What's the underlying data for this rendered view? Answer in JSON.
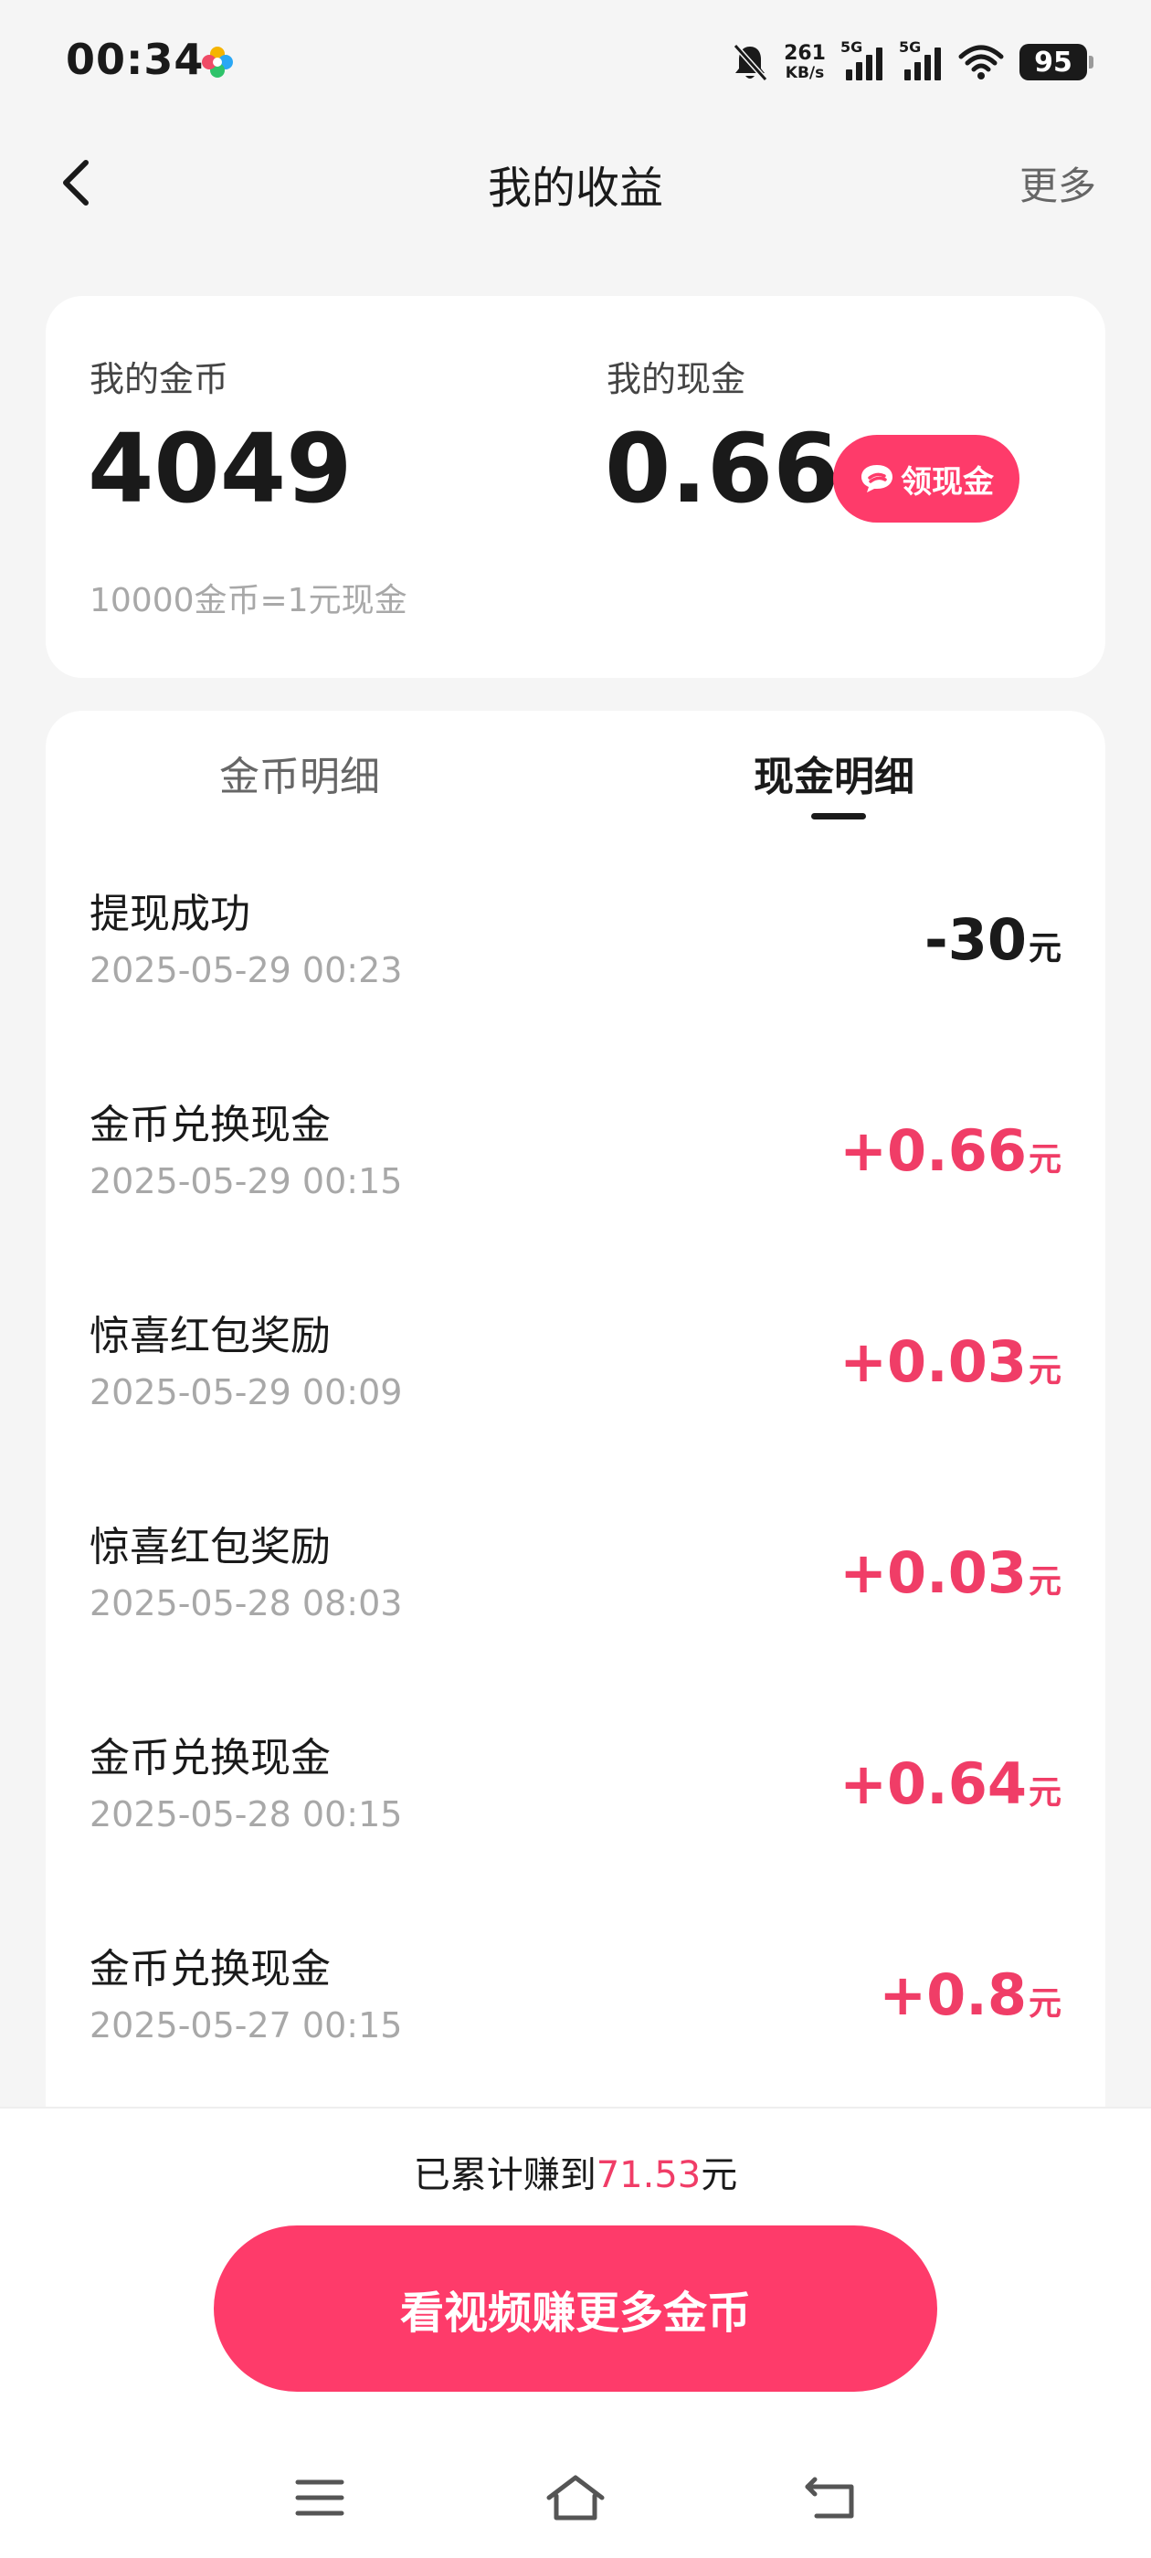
{
  "status_bar": {
    "time": "00:34",
    "net_speed_value": "261",
    "net_speed_unit": "KB/s",
    "sim1": "5G",
    "sim2": "5G",
    "battery": "95"
  },
  "nav": {
    "title": "我的收益",
    "more": "更多"
  },
  "balance": {
    "coin_label": "我的金币",
    "coin_value": "4049",
    "cash_label": "我的现金",
    "cash_value": "0.66",
    "withdraw_label": "领现金",
    "rate_note": "10000金币=1元现金"
  },
  "tabs": {
    "coin": "金币明细",
    "cash": "现金明细",
    "active": "cash"
  },
  "records": [
    {
      "title": "提现成功",
      "time": "2025-05-29 00:23",
      "amount": "-30",
      "unit": "元"
    },
    {
      "title": "金币兑换现金",
      "time": "2025-05-29 00:15",
      "amount": "+0.66",
      "unit": "元"
    },
    {
      "title": "惊喜红包奖励",
      "time": "2025-05-29 00:09",
      "amount": "+0.03",
      "unit": "元"
    },
    {
      "title": "惊喜红包奖励",
      "time": "2025-05-28 08:03",
      "amount": "+0.03",
      "unit": "元"
    },
    {
      "title": "金币兑换现金",
      "time": "2025-05-28 00:15",
      "amount": "+0.64",
      "unit": "元"
    },
    {
      "title": "金币兑换现金",
      "time": "2025-05-27 00:15",
      "amount": "+0.8",
      "unit": "元"
    }
  ],
  "summary": {
    "prefix": "已累计赚到",
    "amount": "71.53",
    "suffix": "元"
  },
  "cta_label": "看视频赚更多金币",
  "colors": {
    "accent": "#fe3b6a",
    "positive": "#f03d67",
    "background": "#f5f5f5"
  },
  "icons": {
    "back": "chevron-left-icon",
    "withdraw": "chat-bubble-icon",
    "nav_menu": "menu-icon",
    "nav_home": "home-icon",
    "nav_back": "return-icon"
  }
}
